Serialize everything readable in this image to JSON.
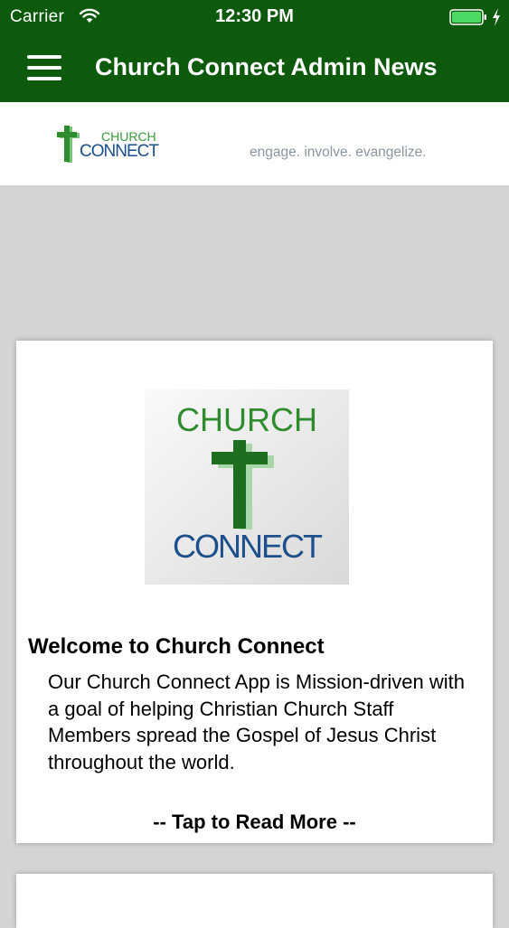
{
  "status_bar": {
    "carrier": "Carrier",
    "time": "12:30 PM",
    "wifi_icon": "wifi-icon",
    "battery_icon": "battery-icon",
    "charging_icon": "bolt-icon"
  },
  "nav_bar": {
    "menu_icon": "hamburger-menu-icon",
    "title": "Church Connect Admin News"
  },
  "brand": {
    "logo_word_top": "CHURCH",
    "logo_word_bottom": "CONNECT",
    "tagline": "engage. involve. evangelize."
  },
  "news_items": [
    {
      "image_word_top": "CHURCH",
      "image_word_bottom": "CONNECT",
      "title": "Welcome to Church Connect",
      "body": "Our Church Connect App is Mission-driven with a goal of helping Christian Church Staff Members spread the Gospel of Jesus Christ throughout the world.",
      "read_more": "-- Tap to Read More --"
    }
  ],
  "colors": {
    "header": "#0d5a0d",
    "background": "#d4d4d4",
    "brand_green": "#2e8b2e",
    "brand_light_green": "#5cb85c",
    "brand_blue": "#1c4f8c",
    "tagline": "#8a95a0"
  }
}
